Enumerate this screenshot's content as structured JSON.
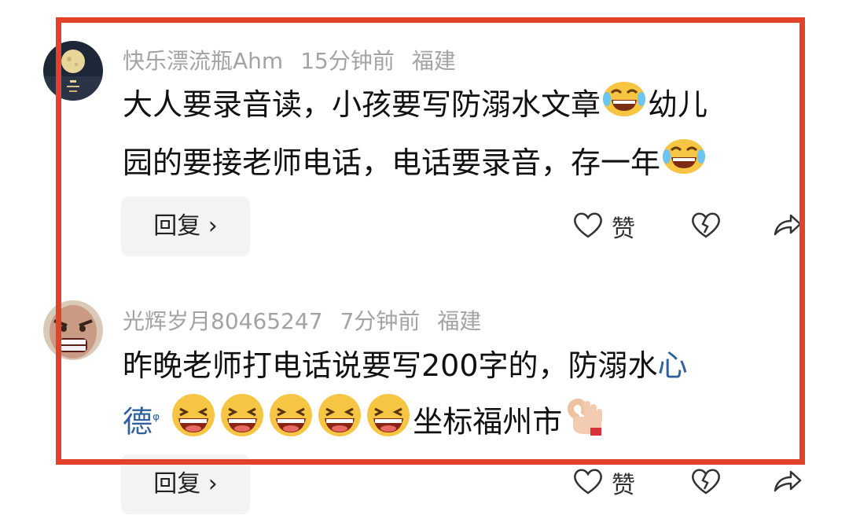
{
  "comments": [
    {
      "user": "快乐漂流瓶Ahm",
      "time": "15分钟前",
      "location": "福建",
      "line1": "大人要录音读，小孩要写防溺水文章",
      "line1b": "幼儿",
      "line2": "园的要接老师电话，电话要录音，存一年",
      "reply_label": "回复 ›",
      "like_label": "赞",
      "avatar_icon": "moon-night-avatar",
      "emoji_icon": "tears-of-joy-emoji"
    },
    {
      "user": "光辉岁月80465247",
      "time": "7分钟前",
      "location": "福建",
      "line1": "昨晚老师打电话说要写200字的，防溺水",
      "link": "心",
      "line2_link": "德",
      "search_mark": "ᵠ",
      "line2_tail": "坐标福州市",
      "reply_label": "回复 ›",
      "like_label": "赞",
      "avatar_icon": "angry-face-avatar",
      "emoji_icon": "grinning-emoji",
      "ok_icon": "ok-hand-emoji"
    }
  ],
  "colors": {
    "frame": "#e2412b",
    "link": "#2f5f9e",
    "meta": "#a3a3a3"
  }
}
